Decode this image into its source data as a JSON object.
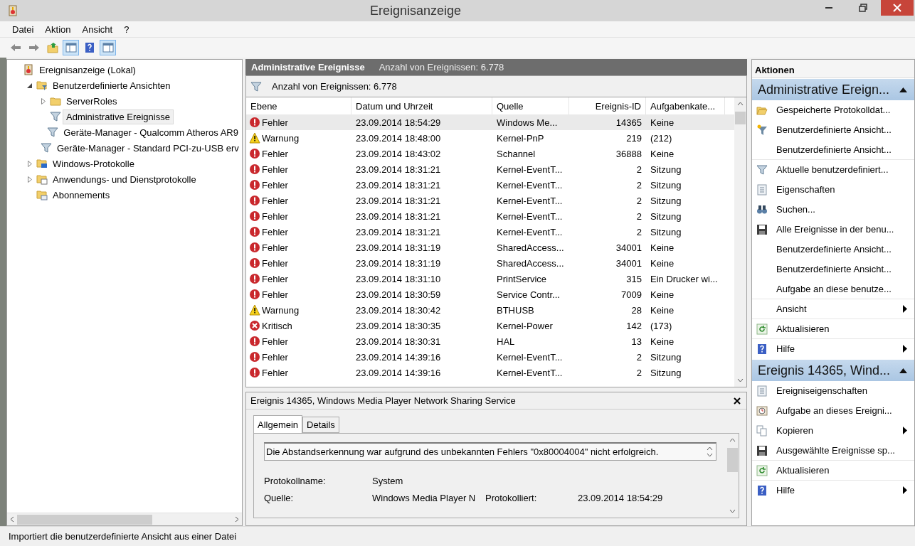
{
  "window": {
    "title": "Ereignisanzeige"
  },
  "menu": [
    {
      "label": "Datei"
    },
    {
      "label": "Aktion"
    },
    {
      "label": "Ansicht"
    },
    {
      "label": "?"
    }
  ],
  "toolbar": [
    {
      "kind": "back",
      "selected": false
    },
    {
      "kind": "forward",
      "selected": false
    },
    {
      "kind": "up",
      "selected": false
    },
    {
      "kind": "tree-pane",
      "selected": true
    },
    {
      "kind": "help",
      "selected": false
    },
    {
      "kind": "action-pane",
      "selected": true
    }
  ],
  "tree": [
    {
      "label": "Ereignisanzeige (Lokal)",
      "kind": "log",
      "selected": false,
      "children": [
        {
          "label": "Benutzerdefinierte Ansichten",
          "kind": "folder-filter",
          "expanded": true,
          "selected": false,
          "children": [
            {
              "label": "ServerRoles",
              "kind": "folder",
              "expanded": false,
              "selected": false
            },
            {
              "label": "Administrative Ereignisse",
              "kind": "filter",
              "selected": true
            },
            {
              "label": "Geräte-Manager - Qualcomm Atheros AR9",
              "kind": "filter",
              "selected": false
            },
            {
              "label": "Geräte-Manager - Standard PCI-zu-USB erv",
              "kind": "filter",
              "selected": false
            }
          ]
        },
        {
          "label": "Windows-Protokolle",
          "kind": "folder-windows",
          "expanded": false,
          "selected": false
        },
        {
          "label": "Anwendungs- und Dienstprotokolle",
          "kind": "folder-app",
          "expanded": false,
          "selected": false
        },
        {
          "label": "Abonnements",
          "kind": "folder-sub",
          "selected": false
        }
      ]
    }
  ],
  "center": {
    "title": "Administrative Ereignisse",
    "count": "Anzahl von Ereignissen: 6.778",
    "filter_text": "Anzahl von Ereignissen: 6.778"
  },
  "table": {
    "columns": [
      "Ebene",
      "Datum und Uhrzeit",
      "Quelle",
      "Ereignis-ID",
      "Aufgabenkate..."
    ],
    "rows": [
      {
        "kind": "error",
        "level": "Fehler",
        "date": "23.09.2014 18:54:29",
        "source": "Windows Me...",
        "id": "14365",
        "category": "Keine",
        "selected": true
      },
      {
        "kind": "warning",
        "level": "Warnung",
        "date": "23.09.2014 18:48:00",
        "source": "Kernel-PnP",
        "id": "219",
        "category": "(212)",
        "selected": false
      },
      {
        "kind": "error",
        "level": "Fehler",
        "date": "23.09.2014 18:43:02",
        "source": "Schannel",
        "id": "36888",
        "category": "Keine",
        "selected": false
      },
      {
        "kind": "error",
        "level": "Fehler",
        "date": "23.09.2014 18:31:21",
        "source": "Kernel-EventT...",
        "id": "2",
        "category": "Sitzung",
        "selected": false
      },
      {
        "kind": "error",
        "level": "Fehler",
        "date": "23.09.2014 18:31:21",
        "source": "Kernel-EventT...",
        "id": "2",
        "category": "Sitzung",
        "selected": false
      },
      {
        "kind": "error",
        "level": "Fehler",
        "date": "23.09.2014 18:31:21",
        "source": "Kernel-EventT...",
        "id": "2",
        "category": "Sitzung",
        "selected": false
      },
      {
        "kind": "error",
        "level": "Fehler",
        "date": "23.09.2014 18:31:21",
        "source": "Kernel-EventT...",
        "id": "2",
        "category": "Sitzung",
        "selected": false
      },
      {
        "kind": "error",
        "level": "Fehler",
        "date": "23.09.2014 18:31:21",
        "source": "Kernel-EventT...",
        "id": "2",
        "category": "Sitzung",
        "selected": false
      },
      {
        "kind": "error",
        "level": "Fehler",
        "date": "23.09.2014 18:31:19",
        "source": "SharedAccess...",
        "id": "34001",
        "category": "Keine",
        "selected": false
      },
      {
        "kind": "error",
        "level": "Fehler",
        "date": "23.09.2014 18:31:19",
        "source": "SharedAccess...",
        "id": "34001",
        "category": "Keine",
        "selected": false
      },
      {
        "kind": "error",
        "level": "Fehler",
        "date": "23.09.2014 18:31:10",
        "source": "PrintService",
        "id": "315",
        "category": "Ein Drucker wi...",
        "selected": false
      },
      {
        "kind": "error",
        "level": "Fehler",
        "date": "23.09.2014 18:30:59",
        "source": "Service Contr...",
        "id": "7009",
        "category": "Keine",
        "selected": false
      },
      {
        "kind": "warning",
        "level": "Warnung",
        "date": "23.09.2014 18:30:42",
        "source": "BTHUSB",
        "id": "28",
        "category": "Keine",
        "selected": false
      },
      {
        "kind": "critical",
        "level": "Kritisch",
        "date": "23.09.2014 18:30:35",
        "source": "Kernel-Power",
        "id": "142",
        "category": "(173)",
        "selected": false
      },
      {
        "kind": "error",
        "level": "Fehler",
        "date": "23.09.2014 18:30:31",
        "source": "HAL",
        "id": "13",
        "category": "Keine",
        "selected": false
      },
      {
        "kind": "error",
        "level": "Fehler",
        "date": "23.09.2014 14:39:16",
        "source": "Kernel-EventT...",
        "id": "2",
        "category": "Sitzung",
        "selected": false
      },
      {
        "kind": "error",
        "level": "Fehler",
        "date": "23.09.2014 14:39:16",
        "source": "Kernel-EventT...",
        "id": "2",
        "category": "Sitzung",
        "selected": false
      }
    ]
  },
  "details": {
    "title": "Ereignis 14365, Windows Media Player Network Sharing Service",
    "tabs": [
      {
        "label": "Allgemein",
        "selected": true
      },
      {
        "label": "Details",
        "selected": false
      }
    ],
    "message": "Die Abstandserkennung war aufgrund des unbekannten Fehlers \"0x80004004\" nicht erfolgreich.",
    "log_name": {
      "label": "Protokollname:",
      "value": "System"
    },
    "source": {
      "label": "Quelle:",
      "value": "Windows Media Player N"
    },
    "logged": {
      "label": "Protokolliert:",
      "value": "23.09.2014 18:54:29"
    }
  },
  "actions": {
    "title": "Aktionen",
    "sections": [
      {
        "title": "Administrative Ereign...",
        "expanded": true,
        "items": [
          {
            "label": "Gespeicherte Protokolldat...",
            "kind": "folder-open",
            "submenu": false,
            "divider": false
          },
          {
            "label": "Benutzerdefinierte Ansicht...",
            "kind": "filter-star",
            "submenu": false,
            "divider": false
          },
          {
            "label": "Benutzerdefinierte Ansicht...",
            "kind": "none",
            "submenu": false,
            "divider": true
          },
          {
            "label": "Aktuelle benutzerdefiniert...",
            "kind": "filter",
            "submenu": false,
            "divider": false
          },
          {
            "label": "Eigenschaften",
            "kind": "properties",
            "submenu": false,
            "divider": false
          },
          {
            "label": "Suchen...",
            "kind": "binoculars",
            "submenu": false,
            "divider": false
          },
          {
            "label": "Alle Ereignisse in der benu...",
            "kind": "save",
            "submenu": false,
            "divider": false
          },
          {
            "label": "Benutzerdefinierte Ansicht...",
            "kind": "none",
            "submenu": false,
            "divider": false
          },
          {
            "label": "Benutzerdefinierte Ansicht...",
            "kind": "none",
            "submenu": false,
            "divider": false
          },
          {
            "label": "Aufgabe an diese benutze...",
            "kind": "none",
            "submenu": false,
            "divider": true
          },
          {
            "label": "Ansicht",
            "kind": "none",
            "submenu": true,
            "divider": true
          },
          {
            "label": "Aktualisieren",
            "kind": "refresh",
            "submenu": false,
            "divider": true
          },
          {
            "label": "Hilfe",
            "kind": "help",
            "submenu": true,
            "divider": false
          }
        ]
      },
      {
        "title": "Ereignis 14365, Wind...",
        "expanded": true,
        "items": [
          {
            "label": "Ereigniseigenschaften",
            "kind": "properties",
            "submenu": false,
            "divider": false
          },
          {
            "label": "Aufgabe an dieses Ereigni...",
            "kind": "task",
            "submenu": false,
            "divider": false
          },
          {
            "label": "Kopieren",
            "kind": "copy",
            "submenu": true,
            "divider": false
          },
          {
            "label": "Ausgewählte Ereignisse sp...",
            "kind": "save",
            "submenu": false,
            "divider": true
          },
          {
            "label": "Aktualisieren",
            "kind": "refresh",
            "submenu": false,
            "divider": true
          },
          {
            "label": "Hilfe",
            "kind": "help",
            "submenu": true,
            "divider": false
          }
        ]
      }
    ]
  },
  "status_bar": "Importiert die benutzerdefinierte Ansicht aus einer Datei"
}
